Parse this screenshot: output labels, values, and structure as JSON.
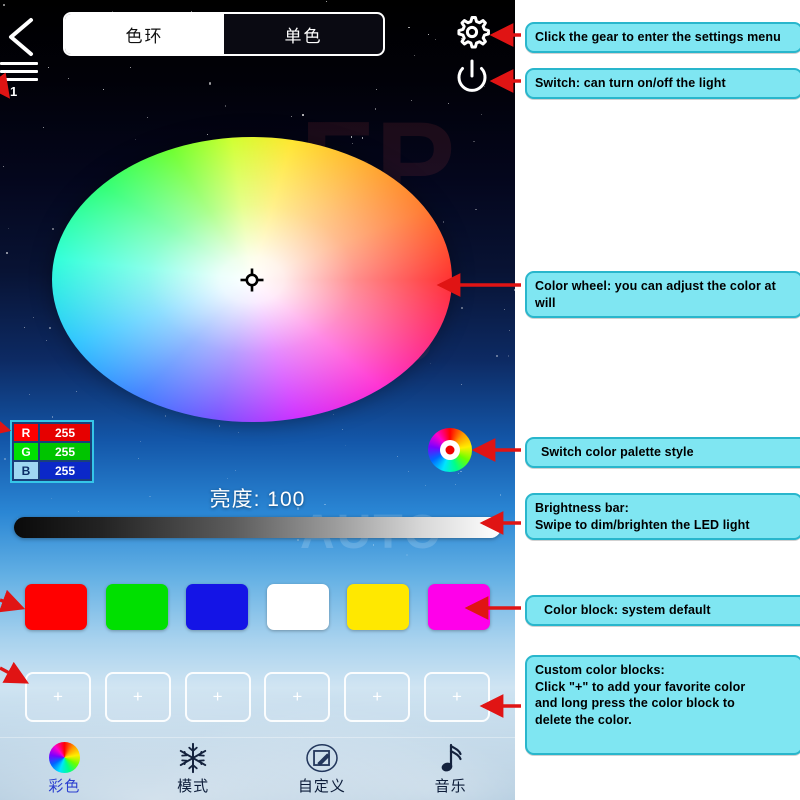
{
  "app": {
    "top": {
      "back_icon": "back-chevron-icon",
      "menu_icon": "hamburger-menu-icon",
      "menu_badge": "1",
      "tabs": [
        {
          "label": "色环",
          "active": true
        },
        {
          "label": "单色",
          "active": false
        }
      ],
      "gear_icon": "gear-icon",
      "power_icon": "power-icon"
    },
    "color_wheel": {
      "name": "color-wheel",
      "cursor_icon": "crosshair-cursor-icon"
    },
    "rgb": {
      "rows": [
        {
          "key": "R",
          "value": "255",
          "key_color": "#ff0000",
          "value_color": "#e60000"
        },
        {
          "key": "G",
          "value": "255",
          "key_color": "#00e000",
          "value_color": "#00c400"
        },
        {
          "key": "B",
          "value": "255",
          "key_color": "#9fd8f2",
          "value_color": "#0b28c8"
        }
      ]
    },
    "palette_toggle": {
      "icon": "color-ring-icon"
    },
    "brightness": {
      "label": "亮度: 100",
      "value": 100
    },
    "swatches": [
      {
        "name": "red",
        "color": "#ff0000"
      },
      {
        "name": "green",
        "color": "#00e000"
      },
      {
        "name": "blue",
        "color": "#1414e6"
      },
      {
        "name": "white",
        "color": "#ffffff"
      },
      {
        "name": "yellow",
        "color": "#ffe800"
      },
      {
        "name": "magenta",
        "color": "#ff00ea"
      }
    ],
    "custom_slots": [
      {
        "label": "+"
      },
      {
        "label": "+"
      },
      {
        "label": "+"
      },
      {
        "label": "+"
      },
      {
        "label": "+"
      },
      {
        "label": "+"
      }
    ],
    "bottom_nav": [
      {
        "label": "彩色",
        "icon": "color-wheel-icon",
        "active": true
      },
      {
        "label": "模式",
        "icon": "snowflake-icon",
        "active": false
      },
      {
        "label": "自定义",
        "icon": "edit-pencil-icon",
        "active": false
      },
      {
        "label": "音乐",
        "icon": "music-note-icon",
        "active": false
      }
    ]
  },
  "annotations": [
    {
      "id": "gear",
      "text": "Click the gear to enter the settings menu"
    },
    {
      "id": "switch",
      "text": "Switch: can turn on/off the light"
    },
    {
      "id": "wheel",
      "text": "Color wheel: you can adjust the color at will"
    },
    {
      "id": "palette",
      "text": "Switch color palette style"
    },
    {
      "id": "brightness",
      "text": "Brightness bar:\nSwipe to dim/brighten the LED light"
    },
    {
      "id": "block",
      "text": "Color block: system default"
    },
    {
      "id": "custom",
      "text": "Custom color blocks:\nClick \"+\" to add your favorite color\nand long press the color block to\ndelete the color."
    }
  ],
  "colors": {
    "callout_fill": "#7fe6f2",
    "callout_border": "#29b6cc",
    "arrow": "#e01414"
  }
}
